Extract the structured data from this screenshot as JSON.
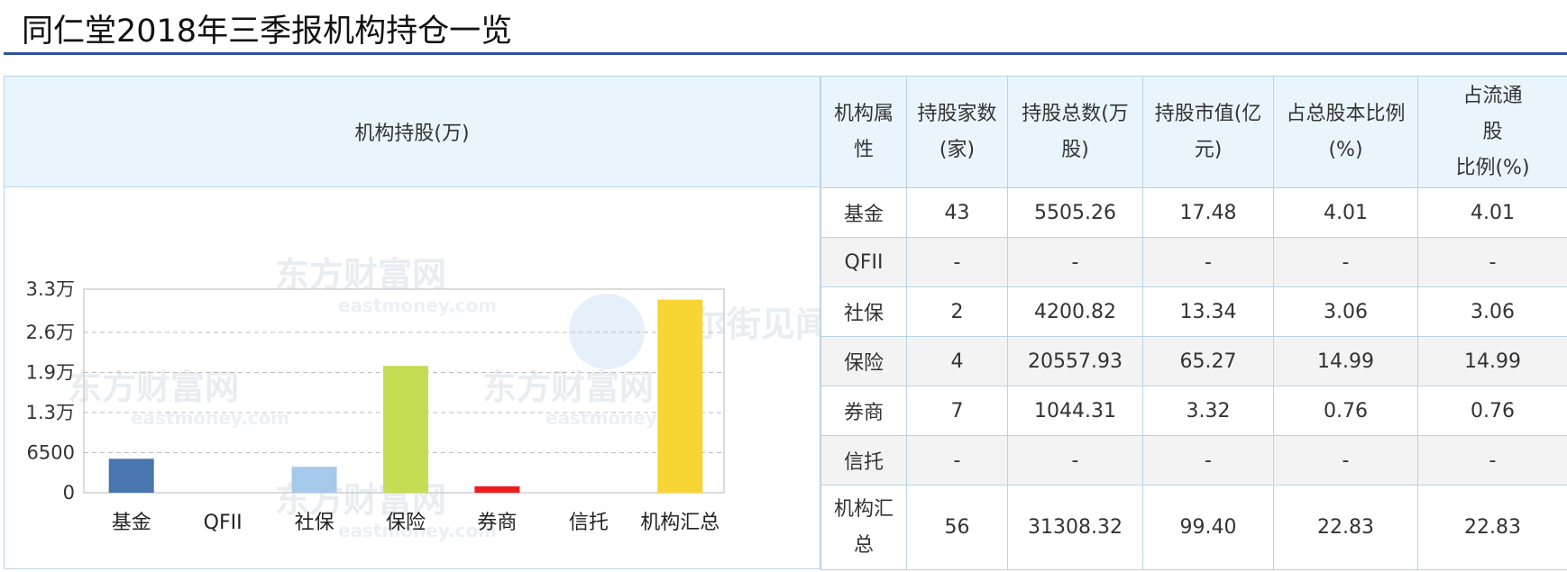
{
  "page": {
    "title": "同仁堂2018年三季报机构持仓一览"
  },
  "chart_panel": {
    "header": "机构持股(万)"
  },
  "watermarks": {
    "eastmoney_cn": "东方财富网",
    "eastmoney_en": "eastmoney.com",
    "wallstreetcn": "华尔街见闻"
  },
  "chart_data": {
    "type": "bar",
    "title": "机构持股(万)",
    "categories": [
      "基金",
      "QFII",
      "社保",
      "保险",
      "券商",
      "信托",
      "机构汇总"
    ],
    "values": [
      5505.26,
      0,
      4200.82,
      20557.93,
      1044.31,
      0,
      31308.32
    ],
    "colors": [
      "#4a76b0",
      "#4a76b0",
      "#a6c8ea",
      "#c5dd52",
      "#ee1c1c",
      "#bbbbbb",
      "#f7d535"
    ],
    "y_ticks": [
      0,
      6500,
      13000,
      19500,
      26000,
      33000
    ],
    "y_tick_labels": [
      "0",
      "6500",
      "1.3万",
      "1.9万",
      "2.6万",
      "3.3万"
    ],
    "ylim": [
      0,
      33000
    ],
    "grid": true
  },
  "table": {
    "headers": [
      "机构属性",
      "持股家数(家)",
      "持股总数(万股)",
      "持股市值(亿元)",
      "占总股本比例(%)",
      "占流通股比例(%)"
    ],
    "headers_display": [
      [
        "机构属",
        "性"
      ],
      [
        "持股家数",
        "(家)"
      ],
      [
        "持股总数(万",
        "股)"
      ],
      [
        "持股市值(亿",
        "元)"
      ],
      [
        "占总股本比例",
        "(%)"
      ],
      [
        "占流通",
        "股",
        "比例(%)"
      ]
    ],
    "rows": [
      [
        "基金",
        "43",
        "5505.26",
        "17.48",
        "4.01",
        "4.01"
      ],
      [
        "QFII",
        "-",
        "-",
        "-",
        "-",
        "-"
      ],
      [
        "社保",
        "2",
        "4200.82",
        "13.34",
        "3.06",
        "3.06"
      ],
      [
        "保险",
        "4",
        "20557.93",
        "65.27",
        "14.99",
        "14.99"
      ],
      [
        "券商",
        "7",
        "1044.31",
        "3.32",
        "0.76",
        "0.76"
      ],
      [
        "信托",
        "-",
        "-",
        "-",
        "-",
        "-"
      ]
    ],
    "total_row": {
      "attr_lines": [
        "机构汇",
        "总"
      ],
      "values": [
        "56",
        "31308.32",
        "99.40",
        "22.83",
        "22.83"
      ]
    }
  }
}
